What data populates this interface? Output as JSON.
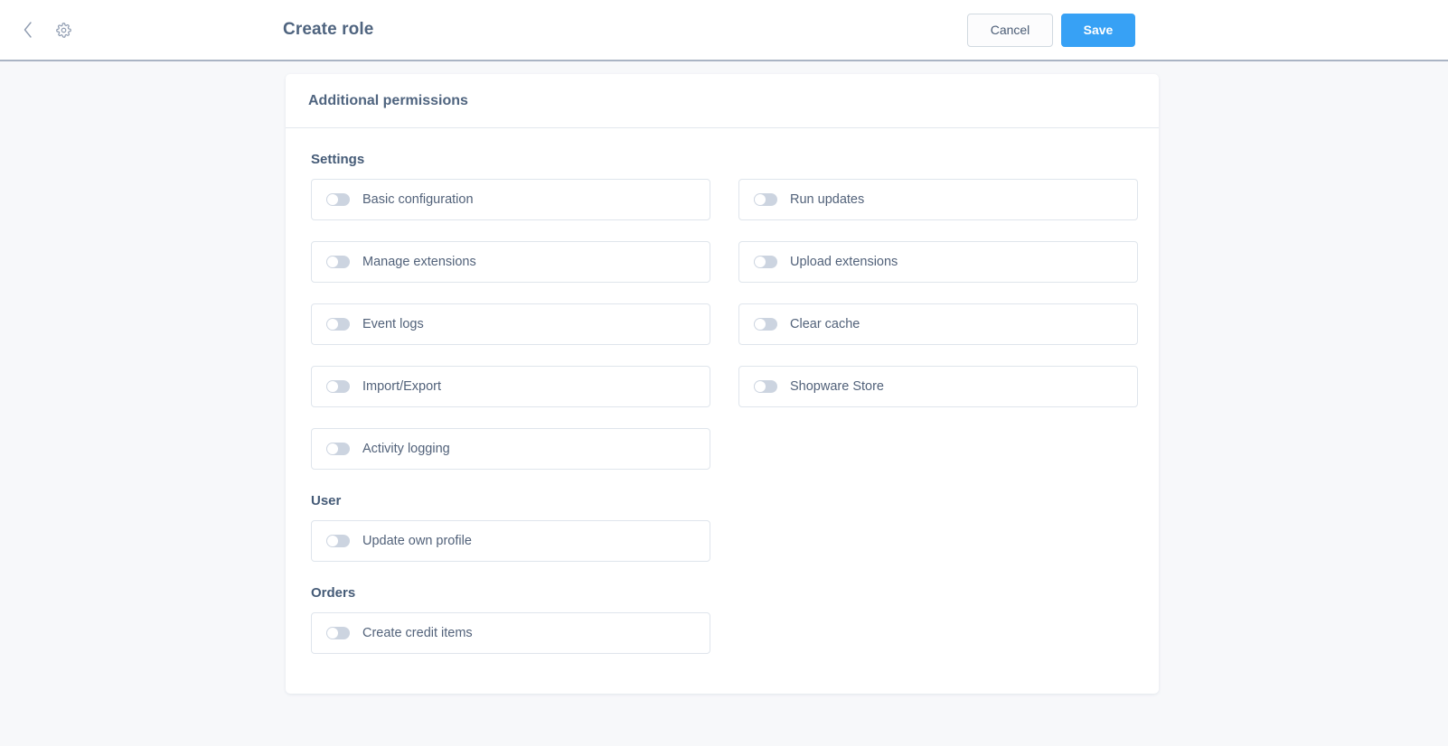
{
  "header": {
    "title": "Create role",
    "back_icon": "chevron-left-icon",
    "settings_icon": "gear-icon",
    "cancel_label": "Cancel",
    "save_label": "Save",
    "save_color": "#37a1f5"
  },
  "card": {
    "title": "Additional permissions"
  },
  "sections": [
    {
      "title": "Settings",
      "columns": 2,
      "items": [
        {
          "label": "Basic configuration",
          "enabled": false
        },
        {
          "label": "Run updates",
          "enabled": false
        },
        {
          "label": "Manage extensions",
          "enabled": false
        },
        {
          "label": "Upload extensions",
          "enabled": false
        },
        {
          "label": "Event logs",
          "enabled": false
        },
        {
          "label": "Clear cache",
          "enabled": false
        },
        {
          "label": "Import/Export",
          "enabled": false
        },
        {
          "label": "Shopware Store",
          "enabled": false
        },
        {
          "label": "Activity logging",
          "enabled": false
        }
      ]
    },
    {
      "title": "User",
      "columns": 1,
      "items": [
        {
          "label": "Update own profile",
          "enabled": false
        }
      ]
    },
    {
      "title": "Orders",
      "columns": 1,
      "items": [
        {
          "label": "Create credit items",
          "enabled": false
        }
      ]
    }
  ]
}
